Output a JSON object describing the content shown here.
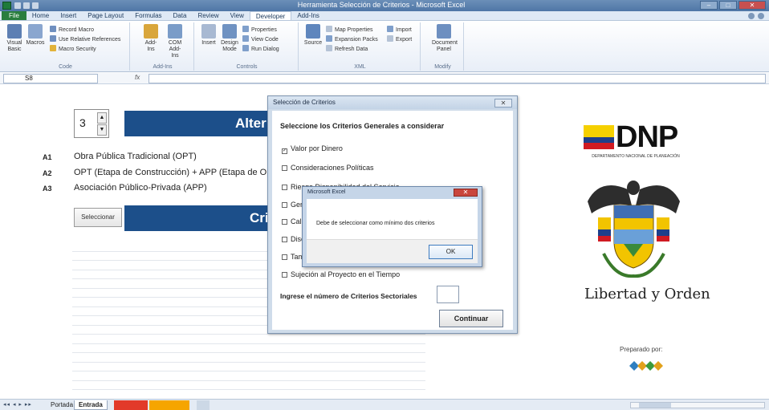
{
  "window": {
    "title": "Herramienta Selección de Criterios - Microsoft Excel",
    "minimize": "–",
    "maximize": "□",
    "close": "✕"
  },
  "ribbon": {
    "tabs": [
      "File",
      "Home",
      "Insert",
      "Page Layout",
      "Formulas",
      "Data",
      "Review",
      "View",
      "Developer",
      "Add-Ins"
    ],
    "active_tab": "Developer",
    "groups": {
      "code": {
        "label": "Code",
        "visual_basic": "Visual Basic",
        "macros": "Macros",
        "record_macro": "Record Macro",
        "relative_refs": "Use Relative References",
        "macro_security": "Macro Security"
      },
      "addins": {
        "label": "Add-Ins",
        "addins": "Add-Ins",
        "com_addins": "COM Add-Ins"
      },
      "controls": {
        "label": "Controls",
        "insert": "Insert",
        "design_mode": "Design Mode",
        "properties": "Properties",
        "view_code": "View Code",
        "run_dialog": "Run Dialog"
      },
      "xml": {
        "label": "XML",
        "source": "Source",
        "map_properties": "Map Properties",
        "expansion_packs": "Expansion Packs",
        "refresh_data": "Refresh Data",
        "import": "Import",
        "export": "Export"
      },
      "modify": {
        "label": "Modify",
        "document_panel": "Document Panel"
      }
    }
  },
  "formula_bar": {
    "name_box": "S8",
    "fx": "fx",
    "value": ""
  },
  "sheet": {
    "spinner_value": "3",
    "band1_label": "Alter",
    "band2_label": "Cri",
    "alternatives": [
      {
        "id": "A1",
        "text": "Obra Pública Tradicional (OPT)"
      },
      {
        "id": "A2",
        "text": "OPT (Etapa de Construcción) + APP (Etapa de Op"
      },
      {
        "id": "A3",
        "text": "Asociación Público-Privada (APP)"
      }
    ],
    "select_button": "Seleccionar"
  },
  "logo_panel": {
    "brand": "DNP",
    "brand_sub": "DEPARTAMENTO NACIONAL DE PLANEACIÓN",
    "motto": "Libertad y Orden",
    "prepared_by": "Preparado por:"
  },
  "dialog": {
    "title": "Selección de Criterios",
    "close": "✕",
    "heading": "Seleccione los Criterios Generales a considerar",
    "criteria": [
      {
        "label": "Valor por Dinero",
        "checked": true
      },
      {
        "label": "Consideraciones Políticas",
        "checked": false
      },
      {
        "label": "Riesgo Disponibilidad del Servicio",
        "checked": false
      },
      {
        "label": "Gen",
        "checked": false
      },
      {
        "label": "Cali",
        "checked": false
      },
      {
        "label": "Dise",
        "checked": false
      },
      {
        "label": "Tam",
        "checked": false
      },
      {
        "label": "Sujeción al Proyecto en el Tiempo",
        "checked": false
      }
    ],
    "prompt": "Ingrese el número de Criterios Sectoriales",
    "continue_button": "Continuar"
  },
  "message_box": {
    "title": "Microsoft Excel",
    "close": "✕",
    "text": "Debe de seleccionar como mínimo dos criterios",
    "ok_button": "OK"
  },
  "sheet_tabs": {
    "nav": "◂◂ ◂ ▸ ▸▸",
    "tabs": [
      "Portada",
      "Entrada"
    ],
    "active": "Entrada"
  }
}
